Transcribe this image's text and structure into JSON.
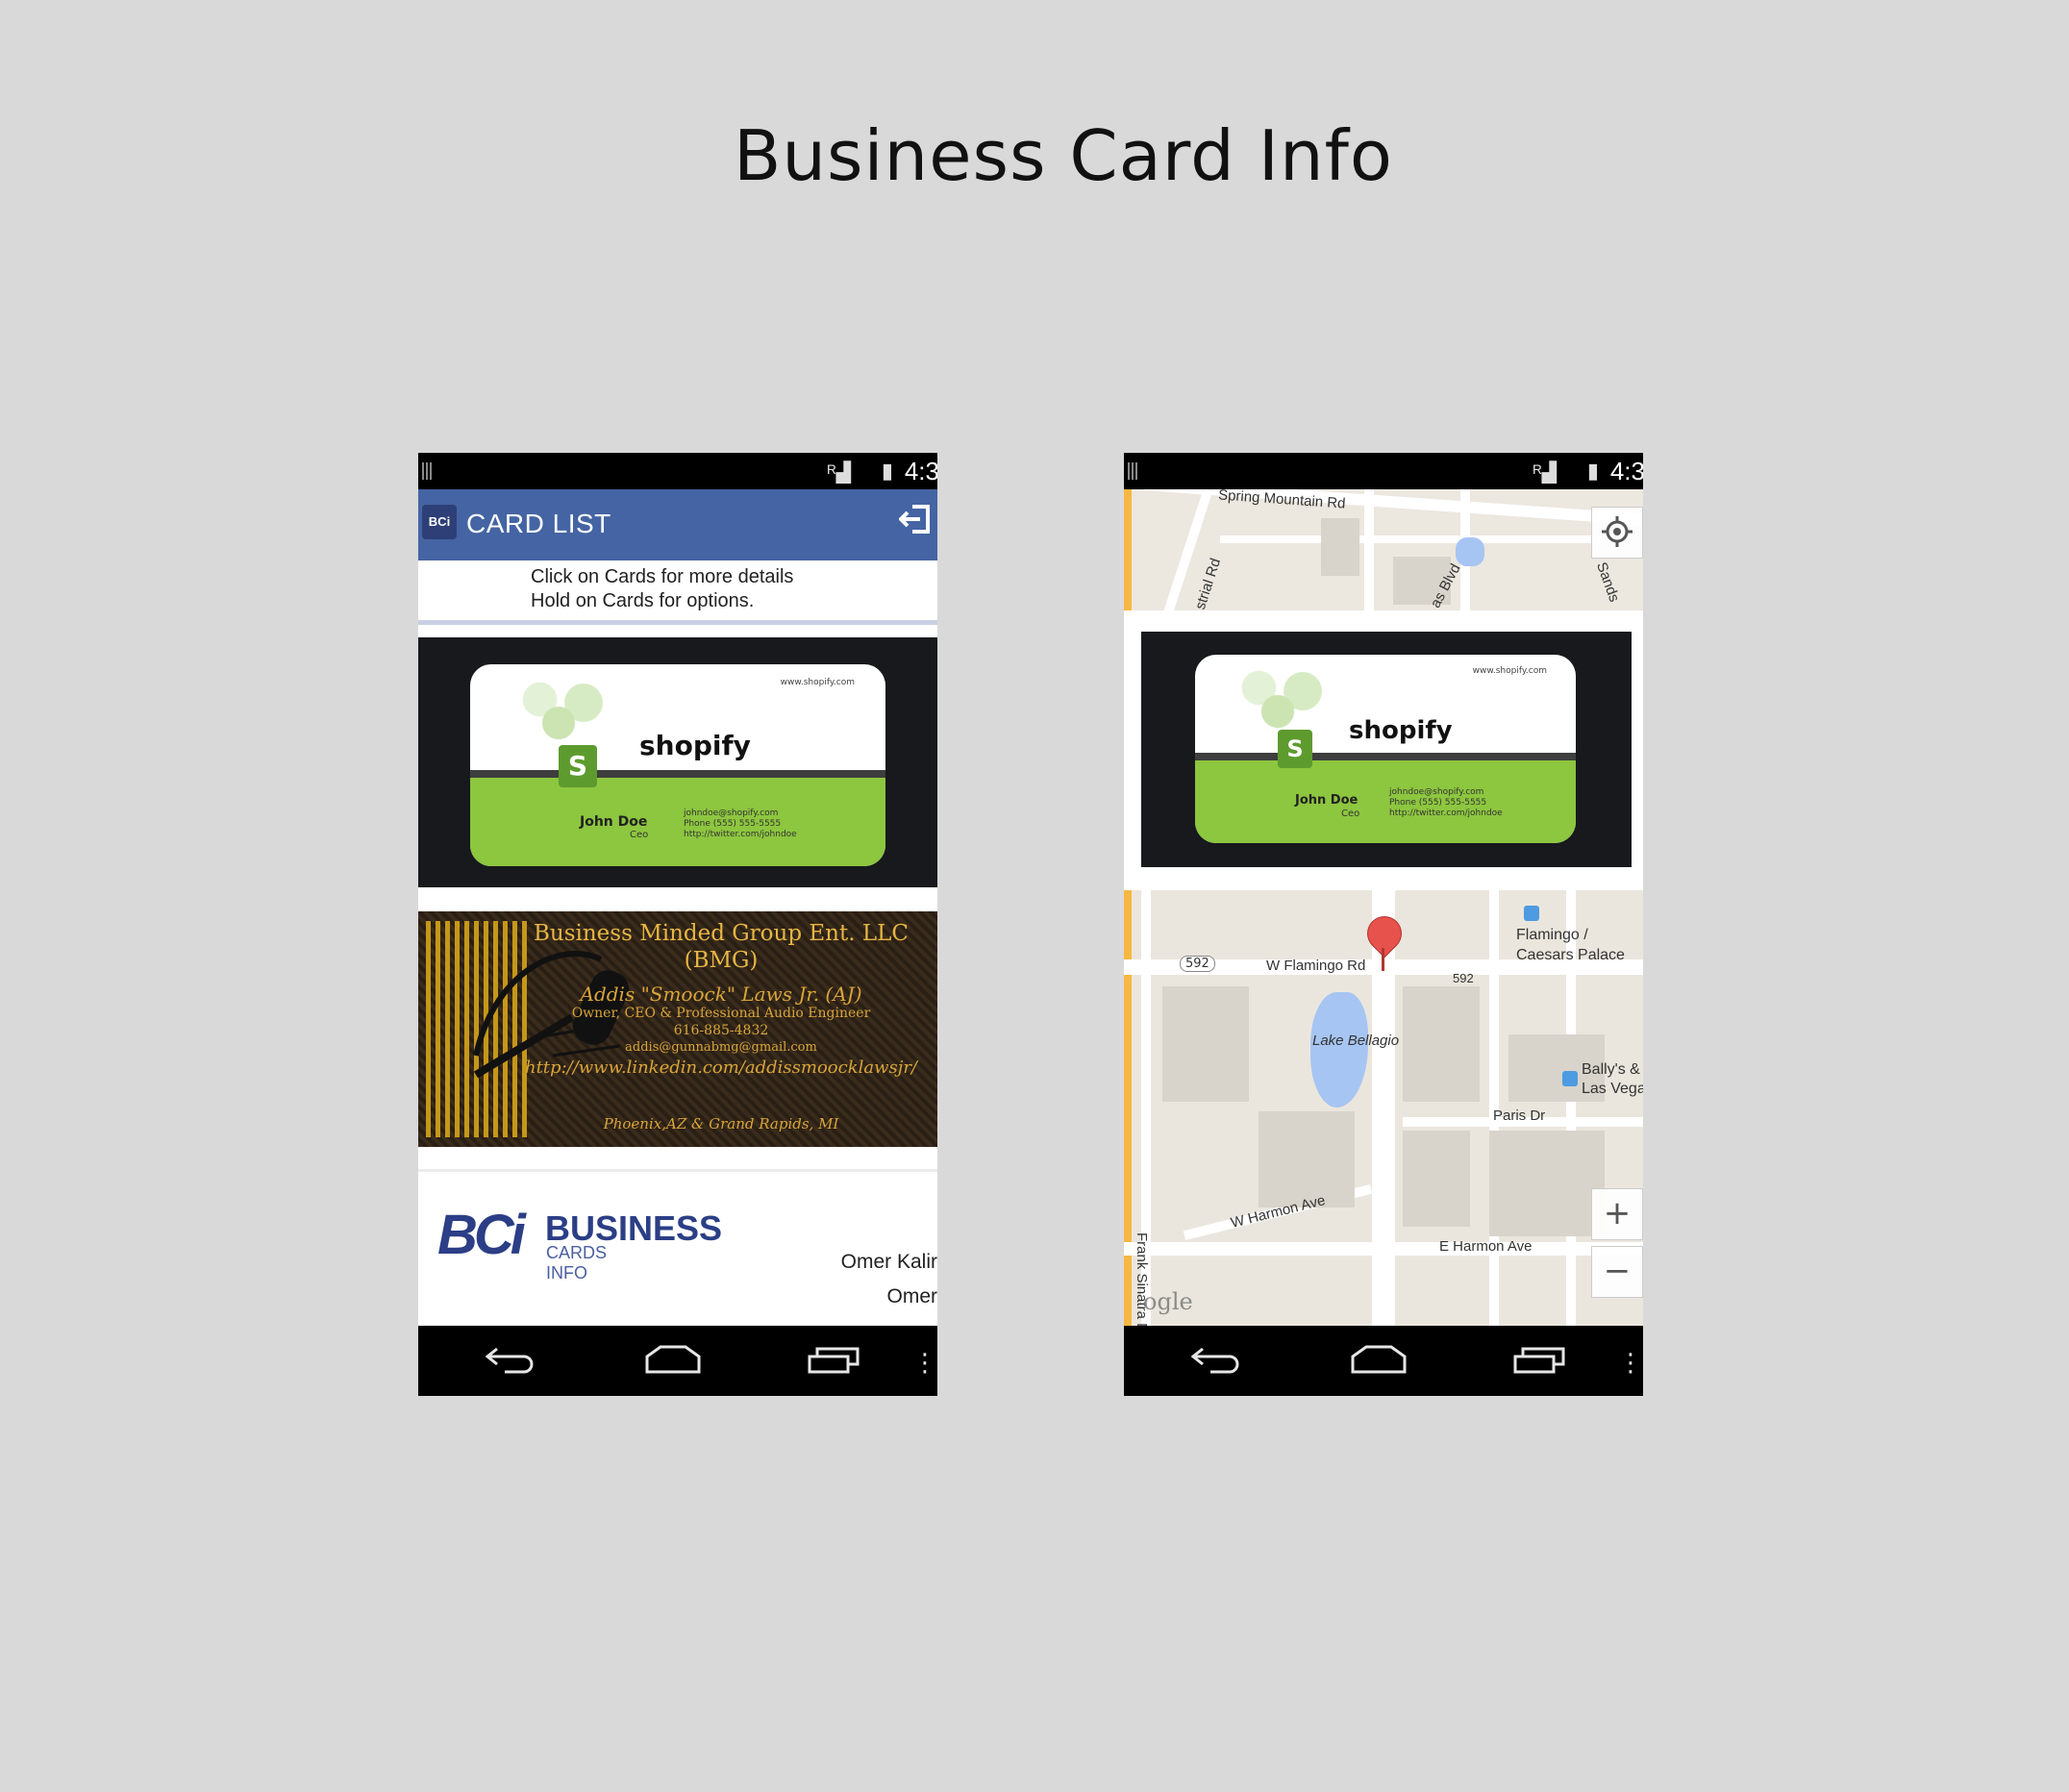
{
  "title": "Business Card Info",
  "status_bar": {
    "time": "4:3"
  },
  "left_screen": {
    "action_bar": {
      "logo_text": "BCi",
      "title": "CARD LIST"
    },
    "hint": {
      "line1": "Click on Cards for more details",
      "line2": "Hold on Cards for options."
    },
    "cards": {
      "shopify": {
        "brand": "shopify",
        "bag_letter": "S",
        "url": "www.shopify.com",
        "person": "John Doe",
        "role": "Ceo",
        "email": "johndoe@shopify.com",
        "phone": "Phone (555) 555-5555",
        "web": "http://twitter.com/johndoe"
      },
      "bmg": {
        "line1": "Business Minded Group Ent. LLC",
        "line2": "(BMG)",
        "line3": "Addis \"Smoock\" Laws Jr. (AJ)",
        "line4": "Owner, CEO & Professional Audio Engineer",
        "line5": "616-885-4832",
        "line6": "addis@gunnabmg@gmail.com",
        "line7": "http://www.linkedin.com/addissmoocklawsjr/",
        "line8": "Phoenix,AZ & Grand Rapids, MI"
      },
      "bci": {
        "logo_big": "BCi",
        "logo_word": "BUSINESS",
        "logo_sub": "CARDS INFO",
        "name1": "Omer Kalir",
        "name2": "Omer"
      }
    }
  },
  "right_screen": {
    "map_top_labels": {
      "spring_mountain": "Spring Mountain Rd",
      "industrial": "strial Rd",
      "vegas_blvd": "as Blvd",
      "sands": "Sands"
    },
    "map_bottom_labels": {
      "flamingo_rd": "W Flamingo Rd",
      "shield_592_left": "592",
      "shield_592_right": "592",
      "flamingo_station_1": "Flamingo /",
      "flamingo_station_2": "Caesars Palace",
      "lake": "Lake Bellagio",
      "ballys_1": "Bally's &",
      "ballys_2": "Las Vega",
      "paris": "Paris Dr",
      "w_harmon": "W Harmon Ave",
      "e_harmon": "E Harmon Ave",
      "frank_sinatra": "Frank Sinatra D",
      "google": "ogle"
    },
    "map_controls": {
      "locate": "locate",
      "zoom_in": "+",
      "zoom_out": "−"
    }
  },
  "colors": {
    "action_bar": "#4464a3",
    "shopify_green": "#8dc63f",
    "bmg_gold": "#e8b643",
    "bci_blue": "#2b3e86",
    "map_pin": "#e8524c"
  }
}
